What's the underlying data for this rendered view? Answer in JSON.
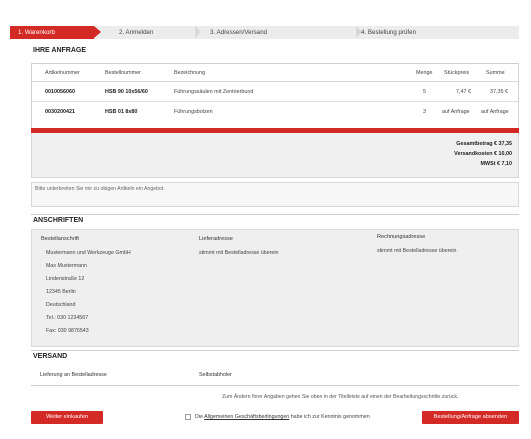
{
  "steps": [
    "1. Warenkorb",
    "2. Anmelden",
    "3. Adressen/Versand",
    "4. Bestellung prüfen"
  ],
  "request": {
    "title": "IHRE ANFRAGE",
    "columns": [
      "Artikelnummer",
      "Bestellnummer",
      "Bezeichnung",
      "Menge",
      "Stückpreis",
      "Summe"
    ],
    "rows": [
      {
        "artikel": "0010056060",
        "bestell": "HSB 90 10x56/60",
        "bezeichnung": "Führungssäulen mit Zentrierbund",
        "menge": "5",
        "stueck": "7,47 €",
        "summe": "37,35 €"
      },
      {
        "artikel": "0030200421",
        "bestell": "HSB 01 8x80",
        "bezeichnung": "Führungsbolzen",
        "menge": "3",
        "stueck": "auf Anfrage",
        "summe": "auf Anfrage"
      }
    ],
    "totals": {
      "gesamt": "Gesamtbetrag € 37,35",
      "versand": "Versandkosten € 10,00",
      "mwst": "MWSt € 7,10"
    },
    "note": "Bitte unterbreiten Sie mir zu obigen Artikeln ein Angebot."
  },
  "addresses": {
    "title": "ANSCHRIFTEN",
    "besteller": {
      "label": "Bestellanschrift",
      "lines": [
        "Mustermann und Werkzeuge GmbH",
        "Max Mustermann",
        "Lindenstraße 12",
        "12345 Berlin",
        "Deutschland",
        "Tel.: 030 1234567",
        "Fax: 030 9876543"
      ]
    },
    "liefer": {
      "label": "Lieferadresse",
      "value": "stimmt mit Bestelladresse überein"
    },
    "rechnung": {
      "label": "Rechnungsadresse",
      "value": "stimmt mit Bestelladresse überein"
    }
  },
  "shipping": {
    "title": "VERSAND",
    "method": "Lieferung an Bestelladresse",
    "option": "Selbstabholer",
    "hint": "Zum Ändern Ihrer Angaben gehen Sie oben in der Titelleiste auf einen der Bearbeitungsschritte zurück."
  },
  "footer": {
    "continue_label": "Weiter einkaufen",
    "agb_prefix": "Die",
    "agb_link": "Allgemeinen Geschäftsbedingungen",
    "agb_suffix": "habe ich zur Kenntnis genommen",
    "submit_label": "Bestellung/Anfrage absenden"
  },
  "colors": {
    "accent": "#d42a26",
    "panel": "#efefef"
  }
}
